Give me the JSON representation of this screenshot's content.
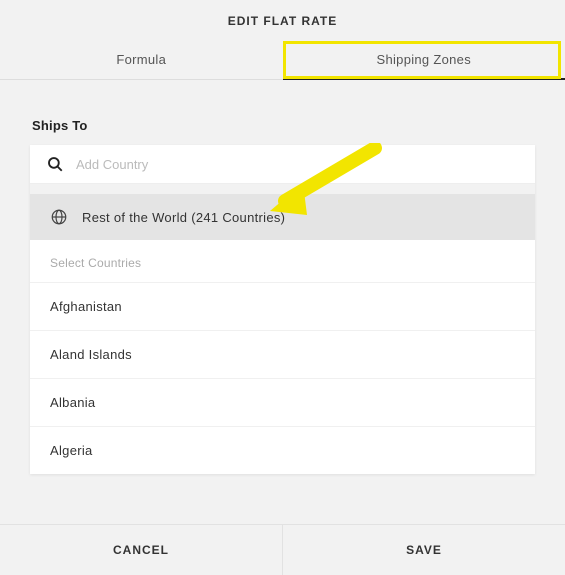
{
  "header": {
    "title": "EDIT FLAT RATE"
  },
  "tabs": {
    "formula": "Formula",
    "shipping_zones": "Shipping Zones"
  },
  "ships_to_label": "Ships To",
  "search": {
    "placeholder": "Add Country"
  },
  "rest_of_world": {
    "label": "Rest of the World (241 Countries)"
  },
  "select_countries_header": "Select Countries",
  "countries": [
    "Afghanistan",
    "Aland Islands",
    "Albania",
    "Algeria"
  ],
  "footer": {
    "cancel": "CANCEL",
    "save": "SAVE"
  }
}
